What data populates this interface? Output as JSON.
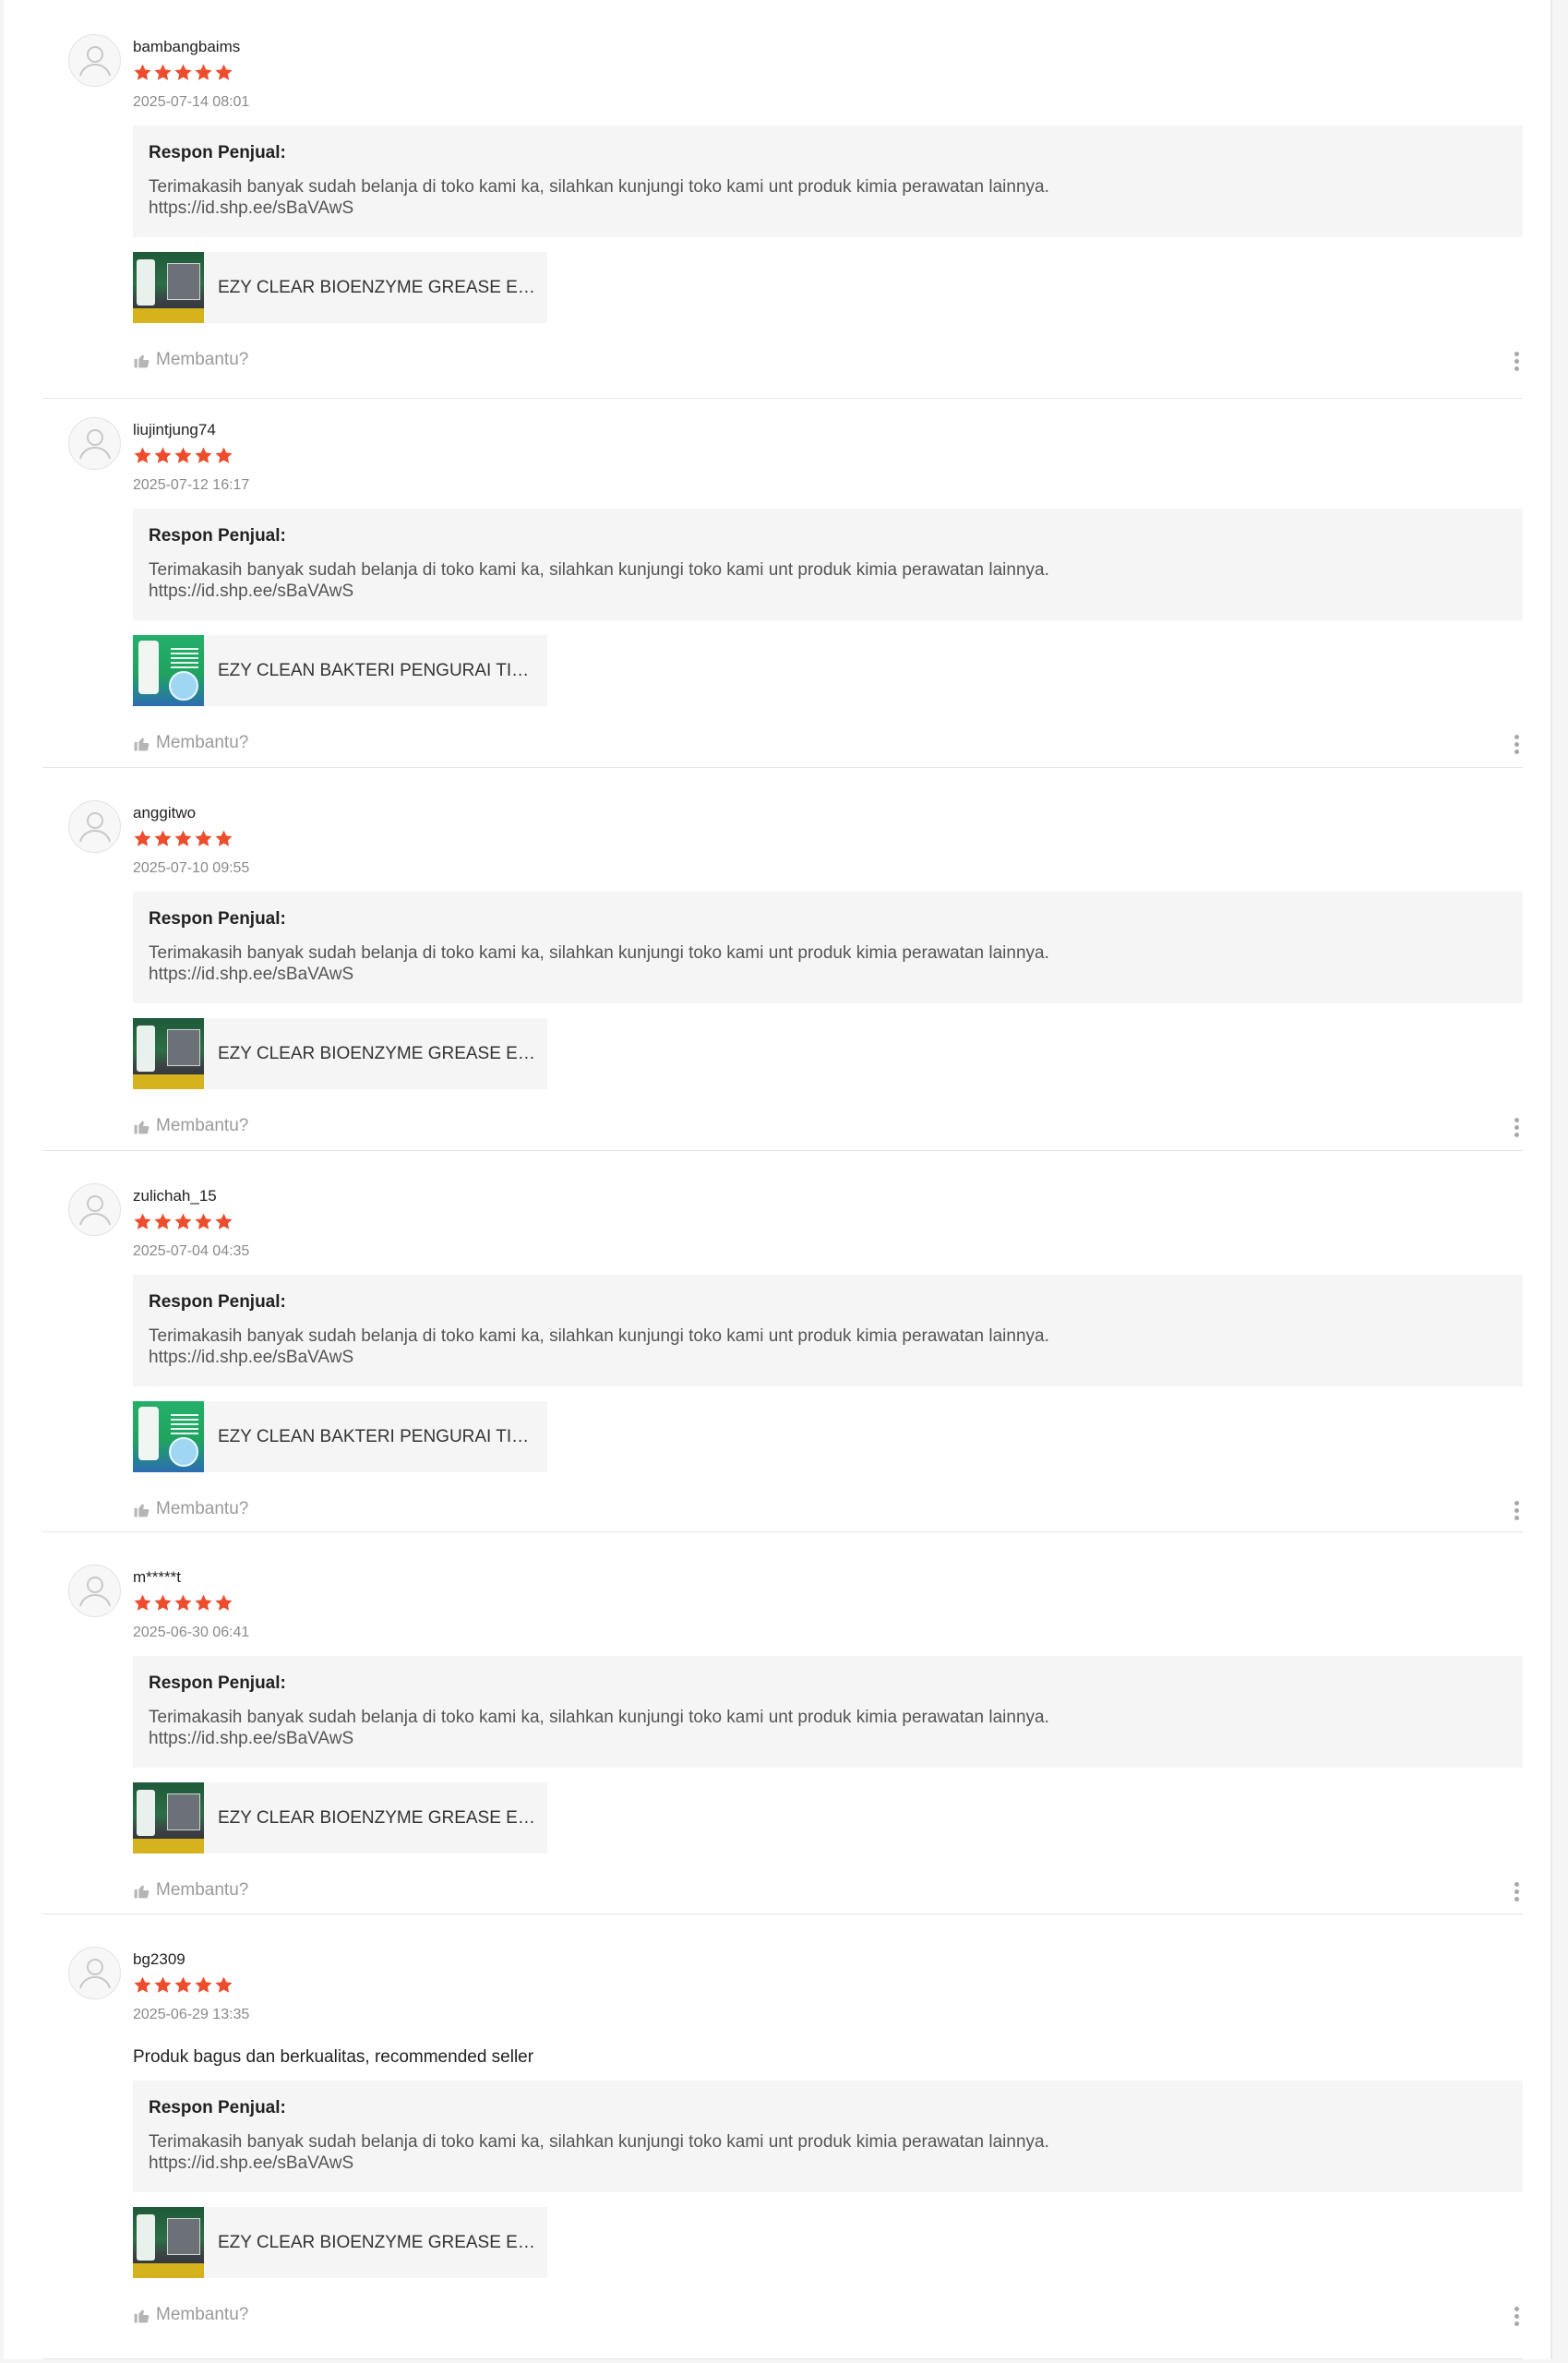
{
  "colors": {
    "star": "#ee4d2d",
    "response_bg": "#f5f5f5",
    "muted": "#9a9a9a"
  },
  "reviews": [
    {
      "username": "bambangbaims",
      "rating": 5,
      "date": "2025-07-14 08:01",
      "comment": "",
      "response_title": "Respon Penjual:",
      "response_text": "Terimakasih banyak sudah belanja di toko kami ka, silahkan kunjungi toko kami unt produk kimia perawatan lainnya.\n https://id.shp.ee/sBaVAwS",
      "product_name": "EZY CLEAR BIOENZYME GREASE EATER",
      "product_thumb": "grease",
      "helpful_label": "Membantu?"
    },
    {
      "username": "liujintjung74",
      "rating": 5,
      "date": "2025-07-12 16:17",
      "comment": "",
      "response_title": "Respon Penjual:",
      "response_text": "Terimakasih banyak sudah belanja di toko kami ka, silahkan kunjungi toko kami unt produk kimia perawatan lainnya.\n https://id.shp.ee/sBaVAwS",
      "product_name": "EZY CLEAN BAKTERI PENGURAI TINJA",
      "product_thumb": "bakteri",
      "helpful_label": "Membantu?"
    },
    {
      "username": "anggitwo",
      "rating": 5,
      "date": "2025-07-10 09:55",
      "comment": "",
      "response_title": "Respon Penjual:",
      "response_text": "Terimakasih banyak sudah belanja di toko kami ka, silahkan kunjungi toko kami unt produk kimia perawatan lainnya.\n https://id.shp.ee/sBaVAwS",
      "product_name": "EZY CLEAR BIOENZYME GREASE EATER",
      "product_thumb": "grease",
      "helpful_label": "Membantu?"
    },
    {
      "username": "zulichah_15",
      "rating": 5,
      "date": "2025-07-04 04:35",
      "comment": "",
      "response_title": "Respon Penjual:",
      "response_text": "Terimakasih banyak sudah belanja di toko kami ka, silahkan kunjungi toko kami unt produk kimia perawatan lainnya.\n https://id.shp.ee/sBaVAwS",
      "product_name": "EZY CLEAN BAKTERI PENGURAI TINJA",
      "product_thumb": "bakteri",
      "helpful_label": "Membantu?"
    },
    {
      "username": "m*****t",
      "rating": 5,
      "date": "2025-06-30 06:41",
      "comment": "",
      "response_title": "Respon Penjual:",
      "response_text": "Terimakasih banyak sudah belanja di toko kami ka, silahkan kunjungi toko kami unt produk kimia perawatan lainnya.\n https://id.shp.ee/sBaVAwS",
      "product_name": "EZY CLEAR BIOENZYME GREASE EATER",
      "product_thumb": "grease",
      "helpful_label": "Membantu?"
    },
    {
      "username": "bg2309",
      "rating": 5,
      "date": "2025-06-29 13:35",
      "comment": "Produk bagus dan berkualitas, recommended seller",
      "response_title": "Respon Penjual:",
      "response_text": "Terimakasih banyak sudah belanja di toko kami ka, silahkan kunjungi toko kami unt produk kimia perawatan lainnya.\n https://id.shp.ee/sBaVAwS",
      "product_name": "EZY CLEAR BIOENZYME GREASE EATER",
      "product_thumb": "grease",
      "helpful_label": "Membantu?"
    }
  ]
}
